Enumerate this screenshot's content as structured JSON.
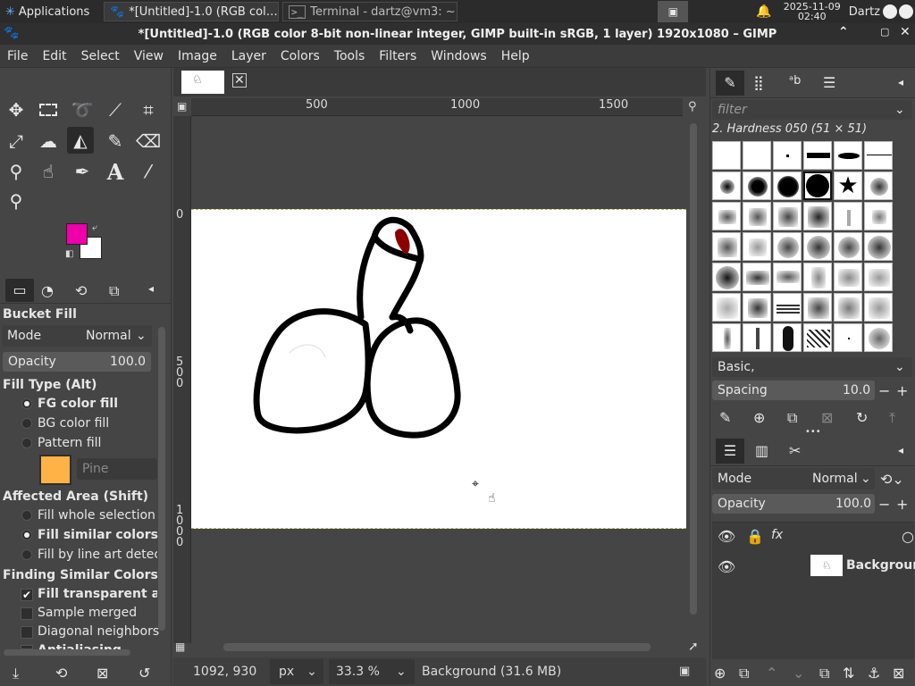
{
  "taskbar": {
    "applications_label": "Applications",
    "window1_label": "*[Untitled]-1.0 (RGB col…",
    "window2_label": "Terminal - dartz@vm3: ~",
    "date": "2025-11-09",
    "time": "02:40",
    "user": "Dartz"
  },
  "window": {
    "title": "*[Untitled]-1.0 (RGB color 8-bit non-linear integer, GIMP built-in sRGB, 1 layer) 1920x1080 – GIMP"
  },
  "menu": [
    "File",
    "Edit",
    "Select",
    "View",
    "Image",
    "Layer",
    "Colors",
    "Tools",
    "Filters",
    "Windows",
    "Help"
  ],
  "colors": {
    "fg": "#ee00aa",
    "bg": "#ffffff",
    "pattern": "#ffb347",
    "accent": "#8b0000"
  },
  "tool_options": {
    "title": "Bucket Fill",
    "mode_label": "Mode",
    "mode_value": "Normal",
    "opacity_label": "Opacity",
    "opacity_value": "100.0",
    "fill_type_header": "Fill Type  (Alt)",
    "fill_types": [
      "FG color fill",
      "BG color fill",
      "Pattern fill"
    ],
    "pattern_name": "Pine",
    "affected_area_header": "Affected Area  (Shift)",
    "affected_areas": [
      "Fill whole selection",
      "Fill similar colors",
      "Fill by line art detect"
    ],
    "finding_header": "Finding Similar Colors",
    "finding_options": [
      "Fill transparent a",
      "Sample merged",
      "Diagonal neighbors",
      "Antialiasing"
    ]
  },
  "rulers": {
    "top": [
      "500",
      "1000",
      "1500"
    ],
    "left_0": "0",
    "left_500": [
      "5",
      "0",
      "0"
    ],
    "left_1000": [
      "1",
      "0",
      "0",
      "0"
    ]
  },
  "status": {
    "coords": "1092, 930",
    "unit": "px",
    "zoom": "33.3 %",
    "info": "Background (31.6 MB)"
  },
  "brushes": {
    "filter_placeholder": "filter",
    "selected_name": "2. Hardness 050 (51 × 51)",
    "preset_tag": "Basic,",
    "spacing_label": "Spacing",
    "spacing_value": "10.0"
  },
  "layers": {
    "mode_label": "Mode",
    "mode_value": "Normal",
    "opacity_label": "Opacity",
    "opacity_value": "100.0",
    "layer_name": "Backgrour"
  }
}
